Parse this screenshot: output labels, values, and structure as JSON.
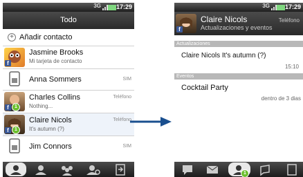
{
  "left": {
    "status": {
      "network": "3G",
      "time": "17:29"
    },
    "title": "Todo",
    "add_contact": "Añadir contacto",
    "contacts": [
      {
        "name": "Jasmine Brooks",
        "sub": "Mi tarjeta de contacto",
        "tag": ""
      },
      {
        "name": "Anna Sommers",
        "sub": "",
        "tag": "SIM"
      },
      {
        "name": "Charles Collins",
        "sub": "Nothing...",
        "tag": "Teléfono",
        "badge": "1"
      },
      {
        "name": "Claire Nicols",
        "sub": "It's autumn (?)",
        "tag": "Teléfono",
        "badge": "1"
      },
      {
        "name": "Jim Connors",
        "sub": "",
        "tag": "SIM"
      }
    ],
    "tabs": [
      "contacts-icon",
      "person-icon",
      "groups-icon",
      "person-search-icon",
      "call-log-icon"
    ]
  },
  "right": {
    "status": {
      "network": "3G",
      "time": "17:29"
    },
    "contact_name": "Claire Nicols",
    "contact_sub": "Actualizaciones y eventos",
    "contact_tag": "Teléfono",
    "updates_label": "Actualizaciones",
    "update_text": "Claire Nicols It's autumn (?)",
    "update_time": "15:10",
    "events_label": "Eventos",
    "event_title": "Cocktail Party",
    "event_when": "dentro de 3 dias",
    "tabs": [
      "message-icon",
      "mail-icon",
      "updates-icon",
      "chat-icon",
      "call-icon"
    ],
    "active_badge": "1"
  },
  "colors": {
    "accent": "#1a4f8f",
    "facebook": "#3b5998",
    "badge": "#6cbf2e"
  }
}
